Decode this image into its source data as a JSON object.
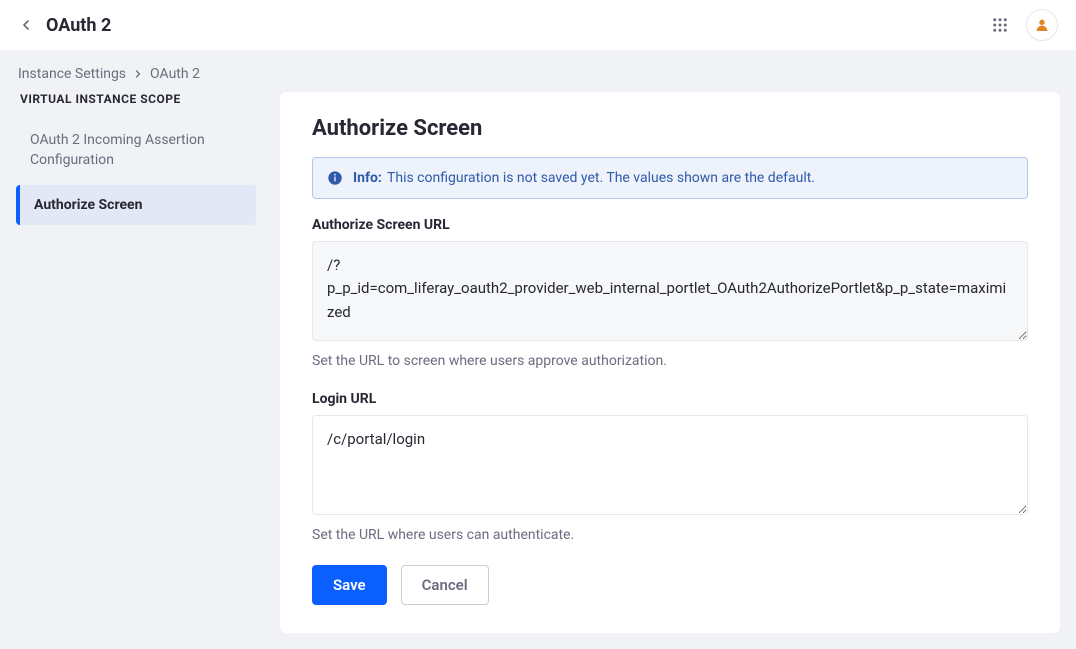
{
  "header": {
    "title": "OAuth 2"
  },
  "breadcrumb": {
    "items": [
      "Instance Settings",
      "OAuth 2"
    ]
  },
  "sidebar": {
    "section_label": "VIRTUAL INSTANCE SCOPE",
    "items": [
      {
        "label": "OAuth 2 Incoming Assertion Configuration",
        "active": false
      },
      {
        "label": "Authorize Screen",
        "active": true
      }
    ]
  },
  "panel": {
    "title": "Authorize Screen",
    "alert": {
      "prefix": "Info:",
      "message": "This configuration is not saved yet. The values shown are the default."
    },
    "fields": {
      "authorize_url": {
        "label": "Authorize Screen URL",
        "value": "/?p_p_id=com_liferay_oauth2_provider_web_internal_portlet_OAuth2AuthorizePortlet&p_p_state=maximized",
        "help": "Set the URL to screen where users approve authorization."
      },
      "login_url": {
        "label": "Login URL",
        "value": "/c/portal/login",
        "help": "Set the URL where users can authenticate."
      }
    },
    "actions": {
      "save": "Save",
      "cancel": "Cancel"
    }
  }
}
